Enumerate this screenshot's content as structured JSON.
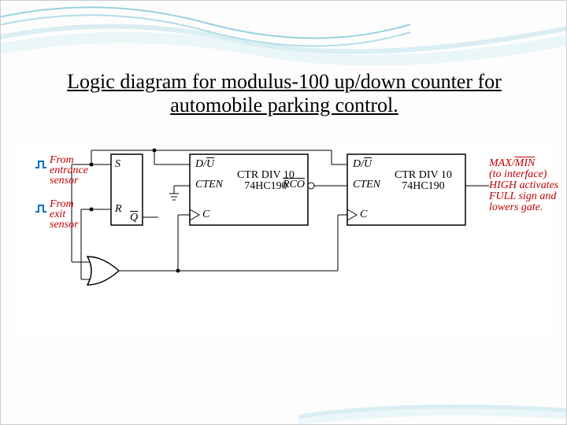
{
  "title_line1": "Logic diagram for modulus-100 up/down counter for",
  "title_line2": "automobile parking control.",
  "inputs": {
    "entrance": "From\nentrance\nsensor",
    "exit": "From\nexit\nsensor"
  },
  "latch": {
    "s": "S",
    "r": "R",
    "qbar": "Q̄"
  },
  "counter": {
    "du": "D/Ū",
    "cten": "CTEN",
    "clk": "C",
    "name": "CTR DIV 10\n74HC190",
    "rco": "RCO"
  },
  "output": {
    "maxmin": "MAX/MIN",
    "desc": "(to interface)\nHIGH activates\nFULL sign and\nlowers gate."
  },
  "pulse_glyph": "⎍"
}
